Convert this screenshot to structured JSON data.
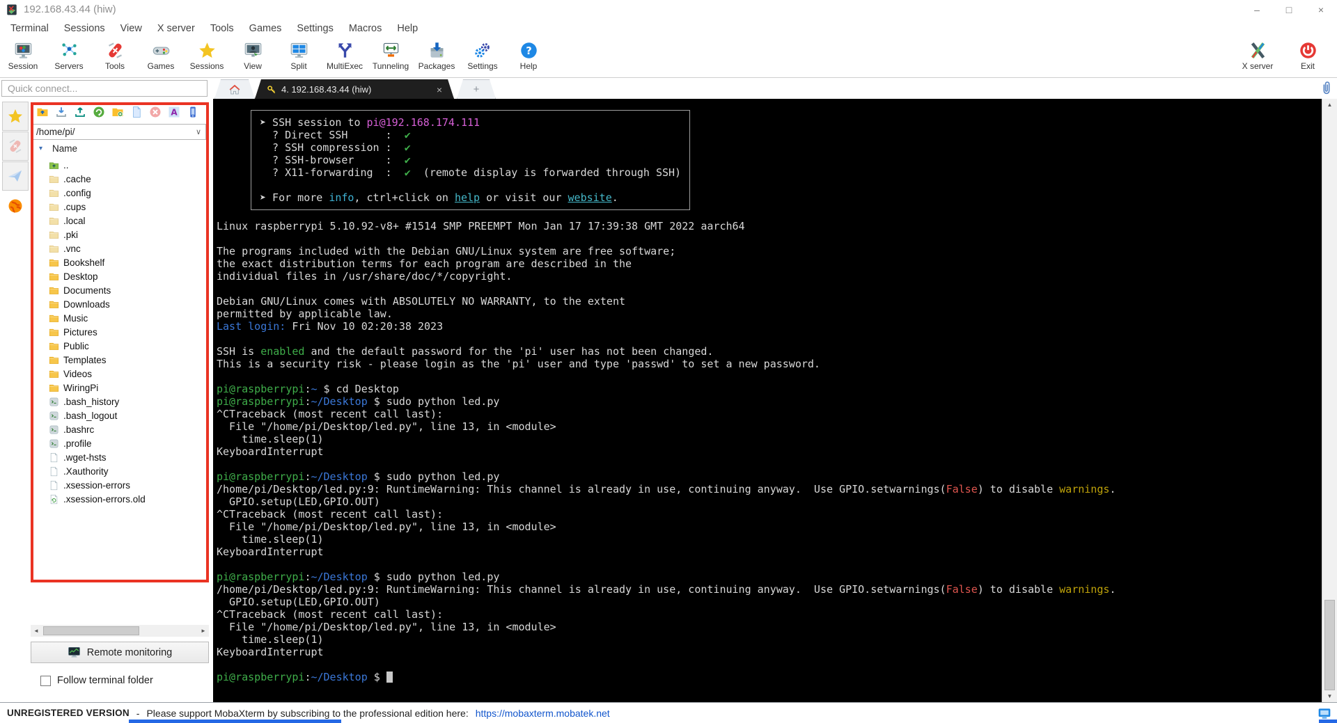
{
  "colors": {
    "bg": "#000000",
    "fg": "#d8d8d8",
    "green": "#3fae4a",
    "blue": "#3b78d8",
    "magenta": "#d65fd6",
    "cyan": "#3fb2d4",
    "red": "#e0564f",
    "yellow": "#bfa30a",
    "link": "#45b8c9",
    "accent_red_box": "#ea3323",
    "status_link": "#1155cc"
  },
  "window": {
    "title": "192.168.43.44 (hiw)",
    "controls": {
      "minimize": "–",
      "maximize": "□",
      "close": "×"
    }
  },
  "menu": {
    "items": [
      "Terminal",
      "Sessions",
      "View",
      "X server",
      "Tools",
      "Games",
      "Settings",
      "Macros",
      "Help"
    ]
  },
  "toolbar": {
    "items": [
      {
        "label": "Session",
        "icon": "session-icon"
      },
      {
        "label": "Servers",
        "icon": "servers-icon"
      },
      {
        "label": "Tools",
        "icon": "tools-icon"
      },
      {
        "label": "Games",
        "icon": "games-icon"
      },
      {
        "label": "Sessions",
        "icon": "sessions-star-icon"
      },
      {
        "label": "View",
        "icon": "view-icon"
      },
      {
        "label": "Split",
        "icon": "split-icon"
      },
      {
        "label": "MultiExec",
        "icon": "multiexec-icon"
      },
      {
        "label": "Tunneling",
        "icon": "tunneling-icon"
      },
      {
        "label": "Packages",
        "icon": "packages-icon"
      },
      {
        "label": "Settings",
        "icon": "settings-icon"
      },
      {
        "label": "Help",
        "icon": "help-icon"
      }
    ],
    "right_items": [
      {
        "label": "X server",
        "icon": "xserver-icon"
      },
      {
        "label": "Exit",
        "icon": "exit-icon"
      }
    ]
  },
  "quick_connect": {
    "placeholder": "Quick connect..."
  },
  "tabs": {
    "active": {
      "label": "4. 192.168.43.44 (hiw)"
    },
    "close_glyph": "×",
    "new_glyph": "+"
  },
  "side_strip": {
    "items": [
      {
        "icon": "sessions-star-icon",
        "active": false
      },
      {
        "icon": "tools-knife-icon",
        "active": false
      },
      {
        "icon": "macros-plane-icon",
        "active": false
      },
      {
        "icon": "sftp-globe-icon",
        "active": true
      }
    ]
  },
  "file_panel": {
    "toolbar_icons": [
      "folder-up-icon",
      "download-icon",
      "upload-icon",
      "refresh-icon",
      "new-folder-icon",
      "new-file-icon",
      "delete-icon",
      "font-icon",
      "device-icon"
    ],
    "path": "/home/pi/",
    "path_chevron": "∨",
    "sort_glyph": "▾",
    "column_header": "Name",
    "entries": [
      {
        "name": "..",
        "type": "up"
      },
      {
        "name": ".cache",
        "type": "folder-hidden"
      },
      {
        "name": ".config",
        "type": "folder-hidden"
      },
      {
        "name": ".cups",
        "type": "folder-hidden"
      },
      {
        "name": ".local",
        "type": "folder-hidden"
      },
      {
        "name": ".pki",
        "type": "folder-hidden"
      },
      {
        "name": ".vnc",
        "type": "folder-hidden"
      },
      {
        "name": "Bookshelf",
        "type": "folder"
      },
      {
        "name": "Desktop",
        "type": "folder"
      },
      {
        "name": "Documents",
        "type": "folder"
      },
      {
        "name": "Downloads",
        "type": "folder"
      },
      {
        "name": "Music",
        "type": "folder"
      },
      {
        "name": "Pictures",
        "type": "folder"
      },
      {
        "name": "Public",
        "type": "folder"
      },
      {
        "name": "Templates",
        "type": "folder"
      },
      {
        "name": "Videos",
        "type": "folder"
      },
      {
        "name": "WiringPi",
        "type": "folder"
      },
      {
        "name": ".bash_history",
        "type": "script"
      },
      {
        "name": ".bash_logout",
        "type": "script"
      },
      {
        "name": ".bashrc",
        "type": "script"
      },
      {
        "name": ".profile",
        "type": "script"
      },
      {
        "name": ".wget-hsts",
        "type": "file"
      },
      {
        "name": ".Xauthority",
        "type": "file"
      },
      {
        "name": ".xsession-errors",
        "type": "file"
      },
      {
        "name": ".xsession-errors.old",
        "type": "file-old"
      }
    ],
    "scroll_glyphs": {
      "left": "◄",
      "right": "►"
    },
    "remote_monitoring_label": "Remote monitoring",
    "follow_label": "Follow terminal folder"
  },
  "terminal": {
    "scroll_glyphs": {
      "up": "▲",
      "down": "▼"
    },
    "banner_lines": [
      [
        {
          "t": "➤ SSH session to "
        },
        {
          "t": "pi@192.168.174.111",
          "c": "magenta"
        }
      ],
      [
        {
          "t": "  ? Direct SSH      :  "
        },
        {
          "t": "✔",
          "c": "green"
        }
      ],
      [
        {
          "t": "  ? SSH compression :  "
        },
        {
          "t": "✔",
          "c": "green"
        }
      ],
      [
        {
          "t": "  ? SSH-browser     :  "
        },
        {
          "t": "✔",
          "c": "green"
        }
      ],
      [
        {
          "t": "  ? X11-forwarding  :  "
        },
        {
          "t": "✔",
          "c": "green"
        },
        {
          "t": "  (remote display is forwarded through SSH)"
        }
      ],
      [
        {
          "t": " "
        }
      ],
      [
        {
          "t": "➤ For more "
        },
        {
          "t": "info",
          "c": "cyan"
        },
        {
          "t": ", ctrl+click on "
        },
        {
          "t": "help",
          "c": "link"
        },
        {
          "t": " or visit our "
        },
        {
          "t": "website",
          "c": "link"
        },
        {
          "t": "."
        }
      ]
    ],
    "lines": [
      [
        {
          "t": "Linux raspberrypi 5.10.92-v8+ #1514 SMP PREEMPT Mon Jan 17 17:39:38 GMT 2022 aarch64"
        }
      ],
      [
        {
          "t": " "
        }
      ],
      [
        {
          "t": "The programs included with the Debian GNU/Linux system are free software;"
        }
      ],
      [
        {
          "t": "the exact distribution terms for each program are described in the"
        }
      ],
      [
        {
          "t": "individual files in /usr/share/doc/*/copyright."
        }
      ],
      [
        {
          "t": " "
        }
      ],
      [
        {
          "t": "Debian GNU/Linux comes with ABSOLUTELY NO WARRANTY, to the extent"
        }
      ],
      [
        {
          "t": "permitted by applicable law."
        }
      ],
      [
        {
          "t": "Last login:",
          "c": "blue"
        },
        {
          "t": " Fri Nov 10 02:20:38 2023"
        }
      ],
      [
        {
          "t": " "
        }
      ],
      [
        {
          "t": "SSH is "
        },
        {
          "t": "enabled",
          "c": "green"
        },
        {
          "t": " and the default password for the 'pi' user has not been changed."
        }
      ],
      [
        {
          "t": "This is a security risk - please login as the 'pi' user and type 'passwd' to set a new password."
        }
      ],
      [
        {
          "t": " "
        }
      ],
      [
        {
          "t": "pi@raspberrypi",
          "c": "green"
        },
        {
          "t": ":"
        },
        {
          "t": "~",
          "c": "blue"
        },
        {
          "t": " $ "
        },
        {
          "t": "cd Desktop"
        }
      ],
      [
        {
          "t": "pi@raspberrypi",
          "c": "green"
        },
        {
          "t": ":"
        },
        {
          "t": "~/Desktop",
          "c": "blue"
        },
        {
          "t": " $ "
        },
        {
          "t": "sudo python led.py"
        }
      ],
      [
        {
          "t": "^CTraceback (most recent call last):"
        }
      ],
      [
        {
          "t": "  File \"/home/pi/Desktop/led.py\", line 13, in <module>"
        }
      ],
      [
        {
          "t": "    time.sleep(1)"
        }
      ],
      [
        {
          "t": "KeyboardInterrupt"
        }
      ],
      [
        {
          "t": " "
        }
      ],
      [
        {
          "t": "pi@raspberrypi",
          "c": "green"
        },
        {
          "t": ":"
        },
        {
          "t": "~/Desktop",
          "c": "blue"
        },
        {
          "t": " $ "
        },
        {
          "t": "sudo python led.py"
        }
      ],
      [
        {
          "t": "/home/pi/Desktop/led.py:9: RuntimeWarning: This channel is already in use, continuing anyway.  Use GPIO.setwarnings("
        },
        {
          "t": "False",
          "c": "red"
        },
        {
          "t": ") to disable "
        },
        {
          "t": "warnings",
          "c": "yellow"
        },
        {
          "t": "."
        }
      ],
      [
        {
          "t": "  GPIO.setup(LED,GPIO.OUT)"
        }
      ],
      [
        {
          "t": "^CTraceback (most recent call last):"
        }
      ],
      [
        {
          "t": "  File \"/home/pi/Desktop/led.py\", line 13, in <module>"
        }
      ],
      [
        {
          "t": "    time.sleep(1)"
        }
      ],
      [
        {
          "t": "KeyboardInterrupt"
        }
      ],
      [
        {
          "t": " "
        }
      ],
      [
        {
          "t": "pi@raspberrypi",
          "c": "green"
        },
        {
          "t": ":"
        },
        {
          "t": "~/Desktop",
          "c": "blue"
        },
        {
          "t": " $ "
        },
        {
          "t": "sudo python led.py"
        }
      ],
      [
        {
          "t": "/home/pi/Desktop/led.py:9: RuntimeWarning: This channel is already in use, continuing anyway.  Use GPIO.setwarnings("
        },
        {
          "t": "False",
          "c": "red"
        },
        {
          "t": ") to disable "
        },
        {
          "t": "warnings",
          "c": "yellow"
        },
        {
          "t": "."
        }
      ],
      [
        {
          "t": "  GPIO.setup(LED,GPIO.OUT)"
        }
      ],
      [
        {
          "t": "^CTraceback (most recent call last):"
        }
      ],
      [
        {
          "t": "  File \"/home/pi/Desktop/led.py\", line 13, in <module>"
        }
      ],
      [
        {
          "t": "    time.sleep(1)"
        }
      ],
      [
        {
          "t": "KeyboardInterrupt"
        }
      ],
      [
        {
          "t": " "
        }
      ],
      [
        {
          "t": "pi@raspberrypi",
          "c": "green"
        },
        {
          "t": ":"
        },
        {
          "t": "~/Desktop",
          "c": "blue"
        },
        {
          "t": " $ "
        },
        {
          "t": " ",
          "c": "cursor"
        }
      ]
    ]
  },
  "statusbar": {
    "unregistered": "UNREGISTERED VERSION",
    "dash": "-",
    "support_text": "Please support MobaXterm by subscribing to the professional edition here:",
    "link": "https://mobaxterm.mobatek.net"
  }
}
